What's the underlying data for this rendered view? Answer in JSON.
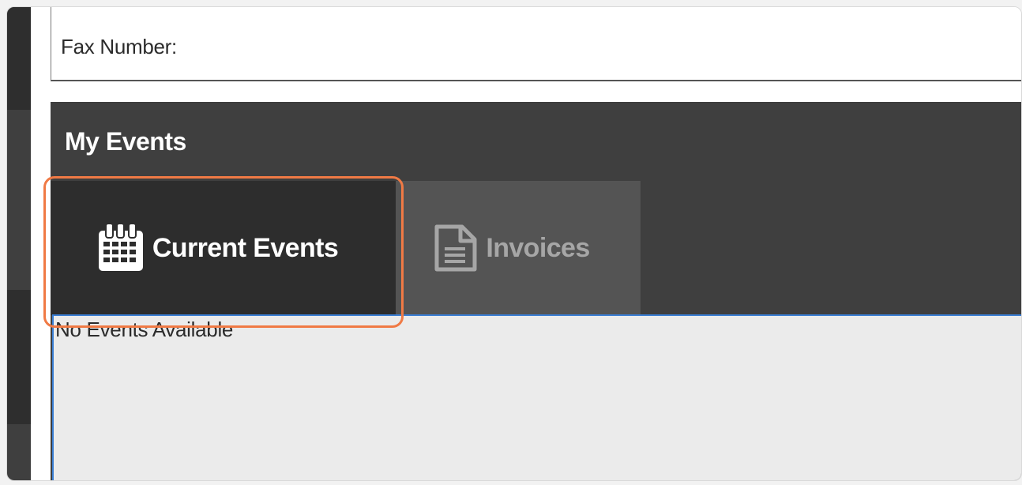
{
  "contact": {
    "fax_label": "Fax Number:"
  },
  "events_panel": {
    "title": "My Events",
    "tabs": [
      {
        "label": "Current Events",
        "icon": "calendar-icon",
        "active": true
      },
      {
        "label": "Invoices",
        "icon": "document-icon",
        "active": false
      }
    ],
    "empty_message": "No Events Available"
  },
  "colors": {
    "panel_bg": "#3f3f3f",
    "active_tab_bg": "#2d2d2d",
    "inactive_tab_bg": "#545454",
    "highlight": "#f07a45",
    "focus_border": "#3b7fd4"
  }
}
